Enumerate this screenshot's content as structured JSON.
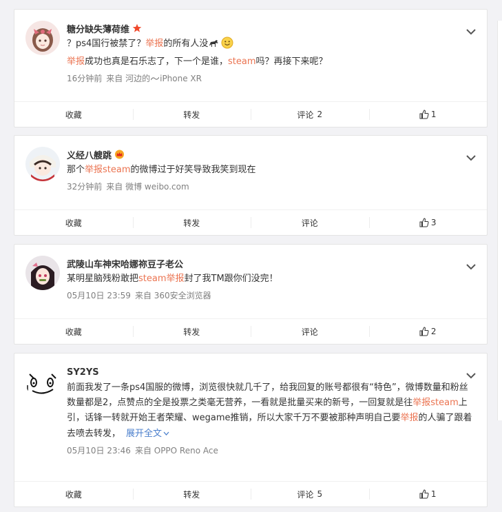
{
  "comments": [
    {
      "name": "糖分缺失薄荷维",
      "badge": "star-badge-icon",
      "lines": [
        {
          "segments": [
            {
              "t": "？ps4国行被禁了？",
              "hl": false
            },
            {
              "t": "举报",
              "hl": true
            },
            {
              "t": "的所有人没",
              "hl": false
            }
          ]
        },
        {
          "segments": [
            {
              "t": "举报",
              "hl": true
            },
            {
              "t": "成功也真是石乐志了，下一个是谁，",
              "hl": false
            },
            {
              "t": "steam",
              "hl": true
            },
            {
              "t": "吗？再接下来呢？",
              "hl": false
            }
          ]
        }
      ],
      "time": "16分钟前",
      "source": "来自 河边的",
      "source_device": "iPhone XR",
      "actions": {
        "favorite": "收藏",
        "repost": "转发",
        "comment": "评论",
        "comment_count": "2",
        "like_count": "1"
      }
    },
    {
      "name": "义经八艘跳",
      "badge": "crown-badge-icon",
      "lines": [
        {
          "segments": [
            {
              "t": "那个",
              "hl": false
            },
            {
              "t": "举报steam",
              "hl": true
            },
            {
              "t": "的微博过于好笑导致我笑到现在",
              "hl": false
            }
          ]
        }
      ],
      "time": "32分钟前",
      "source": "来自 微博 weibo.com",
      "actions": {
        "favorite": "收藏",
        "repost": "转发",
        "comment": "评论",
        "comment_count": "",
        "like_count": "3"
      }
    },
    {
      "name": "武陵山车神宋哈娜祢豆子老公",
      "badge": "",
      "lines": [
        {
          "segments": [
            {
              "t": "某明星脑残粉敢把",
              "hl": false
            },
            {
              "t": "steam举报",
              "hl": true
            },
            {
              "t": "封了我TM跟你们没完！",
              "hl": false
            }
          ]
        }
      ],
      "time": "05月10日 23:59",
      "source": "来自 360安全浏览器",
      "actions": {
        "favorite": "收藏",
        "repost": "转发",
        "comment": "评论",
        "comment_count": "",
        "like_count": "2"
      }
    },
    {
      "name": "SY2YS",
      "badge": "",
      "lines": [
        {
          "segments": [
            {
              "t": "前面我发了一条ps4国服的微博，浏览很快就几千了，给我回复的账号都很有“特色”，微博数量和粉丝数量都是2，点赞点的全是投票之类毫无营养，一看就是批量买来的新号，一回复就是往",
              "hl": false
            },
            {
              "t": "举报steam",
              "hl": true
            },
            {
              "t": "上引，话锋一转就开始王者荣耀、wegame推销，所以大家千万不要被那种声明自己要",
              "hl": false
            },
            {
              "t": "举报",
              "hl": true
            },
            {
              "t": "的人骗了跟着去喷去转发，",
              "hl": false
            }
          ]
        }
      ],
      "expand": "展开全文",
      "time": "05月10日 23:46",
      "source": "来自 OPPO Reno Ace",
      "actions": {
        "favorite": "收藏",
        "repost": "转发",
        "comment": "评论",
        "comment_count": "5",
        "like_count": "1"
      }
    }
  ],
  "colors": {
    "highlight": "#eb7350",
    "link": "#4b7fcc",
    "meta": "#808080",
    "background": "#f2f2f5"
  }
}
